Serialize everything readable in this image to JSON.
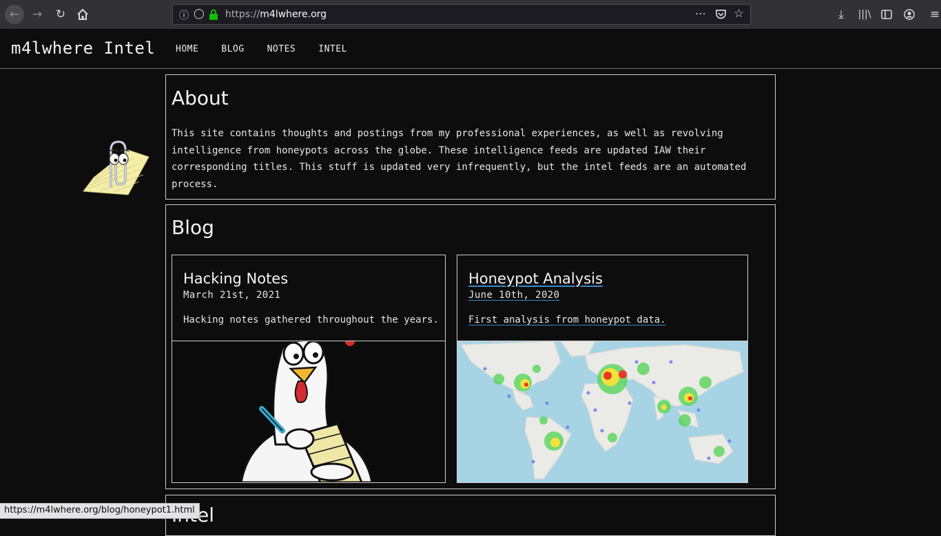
{
  "browser": {
    "url_prefix": "https://",
    "url_host": "m4lwhere.org",
    "status_url": "https://m4lwhere.org/blog/honeypot1.html"
  },
  "site": {
    "brand": "m4lwhere Intel",
    "nav": [
      "HOME",
      "BLOG",
      "NOTES",
      "INTEL"
    ]
  },
  "about": {
    "heading": "About",
    "text": "This site contains thoughts and postings from my professional experiences, as well as revolving intelligence from honeypots across the globe. These intelligence feeds are updated IAW their corresponding titles. This stuff is updated very infrequently, but the intel feeds are an automated process."
  },
  "blog": {
    "heading": "Blog",
    "cards": [
      {
        "title": "Hacking Notes",
        "date": "March 21st, 2021",
        "desc": "Hacking notes gathered throughout the years."
      },
      {
        "title": "Honeypot Analysis",
        "date": "June 10th, 2020",
        "desc": "First analysis from honeypot data."
      }
    ]
  },
  "next_section": {
    "heading": "Intel"
  },
  "colors": {
    "page_bg": "#0d0d0d",
    "border": "#cfcfcf",
    "link_underline": "#3a87c7"
  }
}
